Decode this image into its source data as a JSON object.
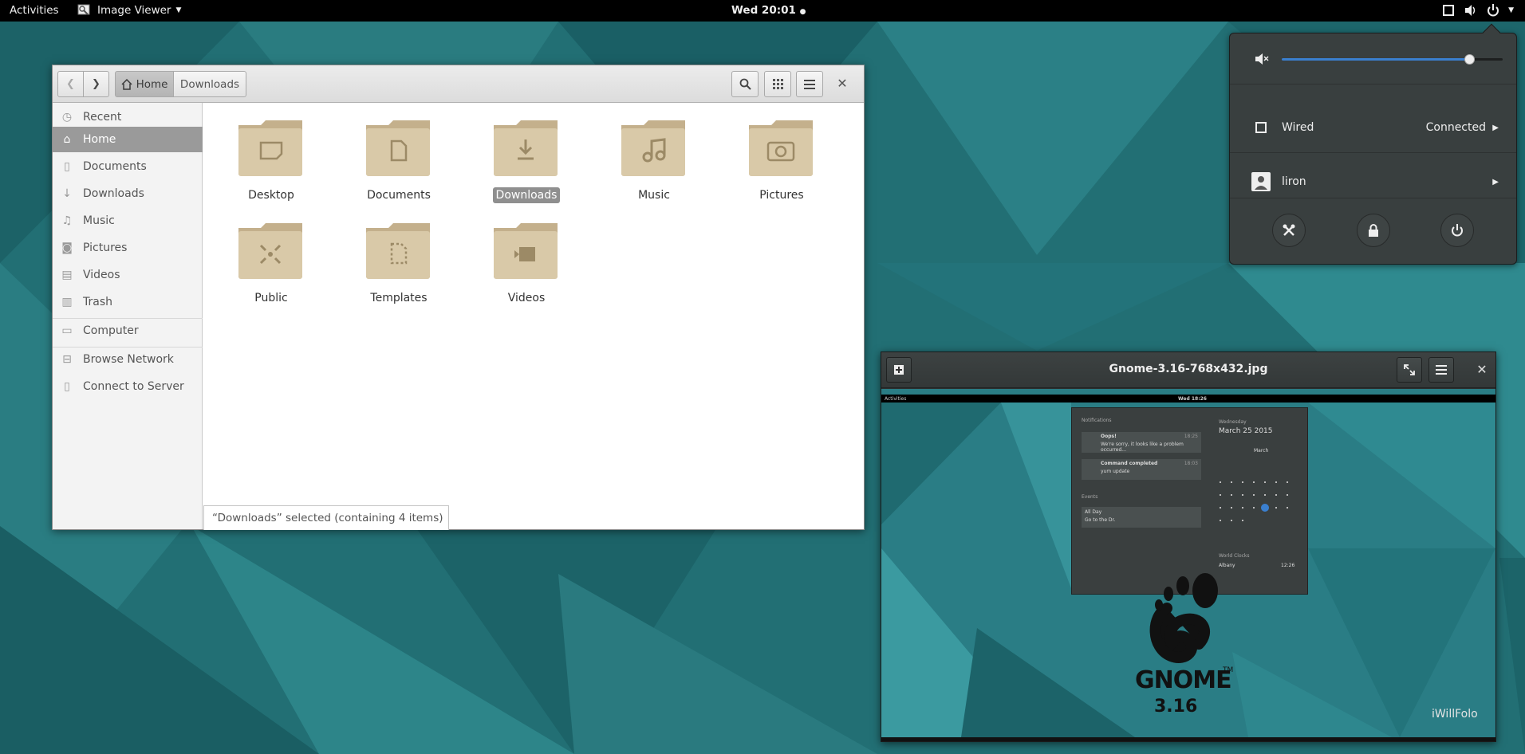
{
  "topbar": {
    "activities": "Activities",
    "app_name": "Image Viewer",
    "clock": "Wed 20:01"
  },
  "files": {
    "breadcrumb": {
      "home": "Home",
      "current": "Downloads"
    },
    "sidebar": {
      "items": [
        {
          "label": "Recent",
          "icon": "clock-icon"
        },
        {
          "label": "Home",
          "icon": "home-icon",
          "active": true
        },
        {
          "label": "Documents",
          "icon": "document-icon"
        },
        {
          "label": "Downloads",
          "icon": "download-icon"
        },
        {
          "label": "Music",
          "icon": "music-icon"
        },
        {
          "label": "Pictures",
          "icon": "camera-icon"
        },
        {
          "label": "Videos",
          "icon": "film-icon"
        },
        {
          "label": "Trash",
          "icon": "trash-icon"
        },
        {
          "label": "Computer",
          "icon": "drive-icon"
        },
        {
          "label": "Browse Network",
          "icon": "network-icon"
        },
        {
          "label": "Connect to Server",
          "icon": "server-icon"
        }
      ]
    },
    "folders": [
      {
        "label": "Desktop"
      },
      {
        "label": "Documents"
      },
      {
        "label": "Downloads",
        "selected": true
      },
      {
        "label": "Music"
      },
      {
        "label": "Pictures"
      },
      {
        "label": "Public"
      },
      {
        "label": "Templates"
      },
      {
        "label": "Videos"
      }
    ],
    "status": "“Downloads” selected  (containing 4 items)"
  },
  "system_menu": {
    "volume_level": 0.85,
    "wired_label": "Wired",
    "wired_status": "Connected",
    "user_name": "liron"
  },
  "viewer": {
    "title": "Gnome-3.16-768x432.jpg",
    "image": {
      "mini_activities": "Activities",
      "mini_clock": "Wed 18:26",
      "notifications_heading": "Notifications",
      "notif1_title": "Oops!",
      "notif1_body": "We're sorry, it looks like a problem occurred...",
      "notif1_time": "18:25",
      "notif2_title": "Command completed",
      "notif2_body": "yum update",
      "notif2_time": "18:03",
      "events_heading": "Events",
      "event_when": "All Day",
      "event_what": "Go to the Dr.",
      "weekday": "Wednesday",
      "date": "March 25 2015",
      "month": "March",
      "world_clocks": "World Clocks",
      "city": "Albany",
      "city_time": "12:26",
      "logo_text": "GNOME",
      "trademark": "TM",
      "version": "3.16",
      "watermark": "iWillFolo"
    }
  },
  "colors": {
    "desktop": "#1f6b70",
    "folder": "#d7c6a5",
    "accent": "#3a7fcf"
  }
}
